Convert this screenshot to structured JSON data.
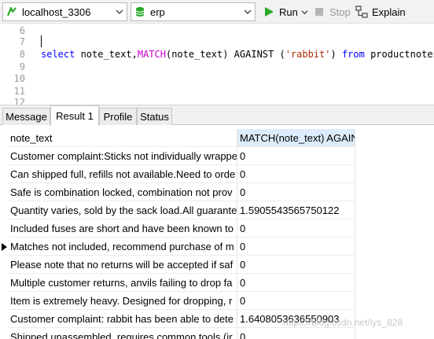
{
  "toolbar": {
    "connection": "localhost_3306",
    "database": "erp",
    "run_label": "Run",
    "stop_label": "Stop",
    "explain_label": "Explain"
  },
  "editor": {
    "line_numbers": [
      "6",
      "7",
      "8",
      "9",
      "10",
      "11",
      "12"
    ],
    "query": {
      "kw_select": "select",
      "part1": " note_text,",
      "fn_match": "MATCH",
      "part2": "(note_text) AGAINST (",
      "str_rabbit": "'rabbit'",
      "part3": ") ",
      "kw_from": "from",
      "part4": " productnotes;"
    }
  },
  "tabs": [
    "Message",
    "Result 1",
    "Profile",
    "Status"
  ],
  "active_tab": "Result 1",
  "grid": {
    "columns": [
      "note_text",
      "MATCH(note_text) AGAIN"
    ],
    "rows": [
      [
        "Customer complaint:Sticks not individually wrappe",
        "0"
      ],
      [
        "Can shipped full, refills not available.Need to orde",
        "0"
      ],
      [
        "Safe is combination locked, combination not prov",
        "0"
      ],
      [
        "Quantity varies, sold by the sack load.All guarante",
        "1.5905543565750122"
      ],
      [
        "Included fuses are short and have been known to",
        "0"
      ],
      [
        "Matches not included, recommend purchase of m",
        "0"
      ],
      [
        "Please note that no returns will be accepted if saf",
        "0"
      ],
      [
        "Multiple customer returns, anvils failing to drop fa",
        "0"
      ],
      [
        "Item is extremely heavy. Designed for dropping, r",
        "0"
      ],
      [
        "Customer complaint: rabbit has been able to dete",
        "1.6408053636550903"
      ],
      [
        "Shipped unassembled, requires common tools (ir",
        "0"
      ]
    ],
    "current_row_index": 5
  },
  "watermark": "https://blog.csdn.net/lys_828"
}
